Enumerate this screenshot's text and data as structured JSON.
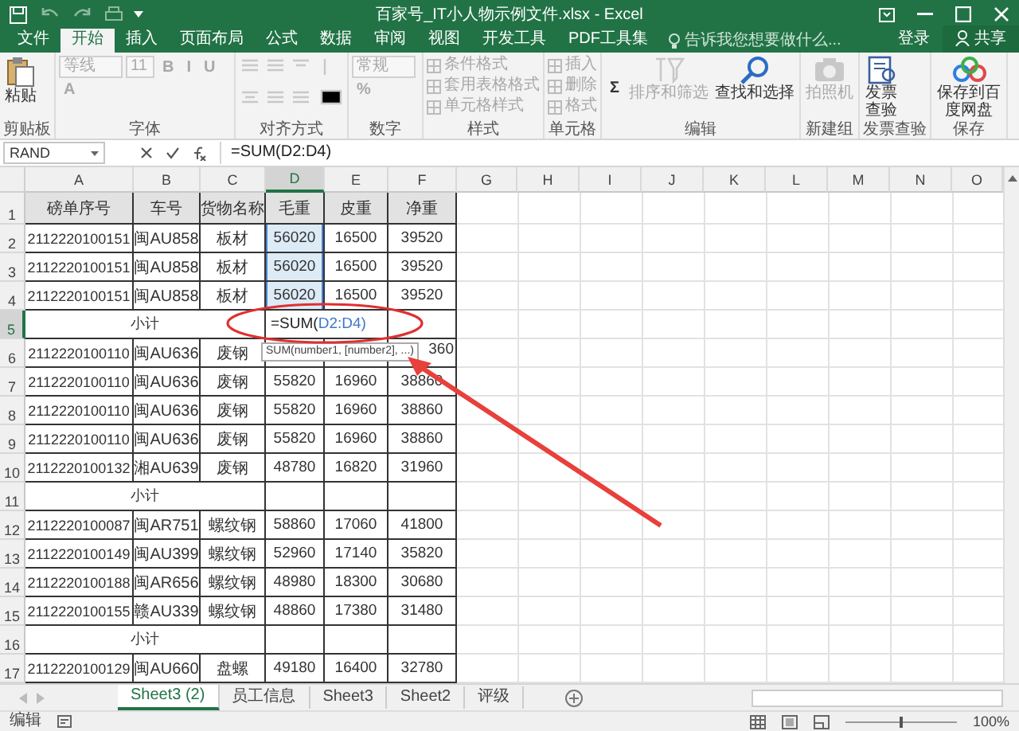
{
  "window": {
    "title": "百家号_IT小人物示例文件.xlsx - Excel"
  },
  "ribbon_tabs": [
    {
      "label": "文件",
      "selected": false
    },
    {
      "label": "开始",
      "selected": true
    },
    {
      "label": "插入",
      "selected": false
    },
    {
      "label": "页面布局",
      "selected": false
    },
    {
      "label": "公式",
      "selected": false
    },
    {
      "label": "数据",
      "selected": false
    },
    {
      "label": "审阅",
      "selected": false
    },
    {
      "label": "视图",
      "selected": false
    },
    {
      "label": "开发工具",
      "selected": false
    },
    {
      "label": "PDF工具集",
      "selected": false
    }
  ],
  "tell_me": {
    "placeholder": "告诉我您想要做什么..."
  },
  "account": {
    "sign_in": "登录",
    "share": "共享"
  },
  "ribbon_groups": [
    {
      "label": "剪贴板",
      "items": [
        {
          "kind": "paste",
          "label": "粘贴",
          "disabled": false
        }
      ]
    },
    {
      "label": "字体",
      "items": [
        {
          "kind": "field",
          "label": "等线",
          "disabled": true
        },
        {
          "kind": "field",
          "label": "11",
          "disabled": true
        },
        {
          "kind": "glyph",
          "label": "B",
          "disabled": true
        },
        {
          "kind": "glyph",
          "label": "I",
          "disabled": true
        },
        {
          "kind": "glyph",
          "label": "U",
          "disabled": true
        },
        {
          "kind": "glyph",
          "label": "A",
          "disabled": true
        }
      ]
    },
    {
      "label": "对齐方式",
      "items": [
        {
          "kind": "align",
          "disabled": true
        }
      ]
    },
    {
      "label": "数字",
      "items": [
        {
          "kind": "field",
          "label": "常规",
          "disabled": true
        },
        {
          "kind": "glyph",
          "label": "%",
          "disabled": true
        }
      ]
    },
    {
      "label": "样式",
      "items": [
        {
          "kind": "small",
          "label": "条件格式",
          "disabled": true
        },
        {
          "kind": "small",
          "label": "套用表格格式",
          "disabled": true
        },
        {
          "kind": "small",
          "label": "单元格样式",
          "disabled": true
        }
      ]
    },
    {
      "label": "单元格",
      "items": [
        {
          "kind": "small",
          "label": "插入",
          "disabled": true
        },
        {
          "kind": "small",
          "label": "删除",
          "disabled": true
        },
        {
          "kind": "small",
          "label": "格式",
          "disabled": true
        }
      ]
    },
    {
      "label": "编辑",
      "items": [
        {
          "kind": "glyph",
          "label": "Σ",
          "disabled": false
        },
        {
          "kind": "sort",
          "label": "排序和筛选",
          "disabled": true
        },
        {
          "kind": "find",
          "label": "查找和选择",
          "disabled": false
        }
      ]
    },
    {
      "label": "新建组",
      "items": [
        {
          "kind": "camera",
          "label": "拍照机",
          "disabled": true
        }
      ]
    },
    {
      "label": "发票查验",
      "items": [
        {
          "kind": "invoice",
          "label": "发票查验",
          "disabled": false
        }
      ]
    },
    {
      "label": "保存",
      "items": [
        {
          "kind": "cloud",
          "label": "保存到百度网盘",
          "disabled": false
        }
      ]
    }
  ],
  "name_box": "RAND",
  "formula_bar": {
    "value": "=SUM(D2:D4)"
  },
  "columns": [
    {
      "label": "A",
      "selected": false
    },
    {
      "label": "B",
      "selected": false
    },
    {
      "label": "C",
      "selected": false
    },
    {
      "label": "D",
      "selected": true
    },
    {
      "label": "E",
      "selected": false
    },
    {
      "label": "F",
      "selected": false
    },
    {
      "label": "G",
      "selected": false
    },
    {
      "label": "H",
      "selected": false
    },
    {
      "label": "I",
      "selected": false
    },
    {
      "label": "J",
      "selected": false
    },
    {
      "label": "K",
      "selected": false
    },
    {
      "label": "L",
      "selected": false
    },
    {
      "label": "M",
      "selected": false
    },
    {
      "label": "N",
      "selected": false
    },
    {
      "label": "O",
      "selected": false
    }
  ],
  "rows": [
    {
      "number": "1",
      "kind": "header",
      "selected": false,
      "referenced": false,
      "cells": {
        "A": "磅单序号",
        "B": "车号",
        "C": "货物名称",
        "D": "毛重",
        "E": "皮重",
        "F": "净重"
      }
    },
    {
      "number": "2",
      "kind": "data",
      "selected": false,
      "referenced": true,
      "cells": {
        "A": "2112220100151",
        "B": "闽AU858",
        "C": "板材",
        "D": "56020",
        "E": "16500",
        "F": "39520"
      }
    },
    {
      "number": "3",
      "kind": "data",
      "selected": false,
      "referenced": true,
      "cells": {
        "A": "2112220100151",
        "B": "闽AU858",
        "C": "板材",
        "D": "56020",
        "E": "16500",
        "F": "39520"
      }
    },
    {
      "number": "4",
      "kind": "data",
      "selected": false,
      "referenced": true,
      "cells": {
        "A": "2112220100151",
        "B": "闽AU858",
        "C": "板材",
        "D": "56020",
        "E": "16500",
        "F": "39520"
      }
    },
    {
      "number": "5",
      "kind": "editing",
      "selected": true,
      "referenced": false,
      "cells": {
        "A": "小计"
      },
      "edit": {
        "func": "=SUM(",
        "ref": "D2:D4)"
      }
    },
    {
      "number": "6",
      "kind": "covered",
      "selected": false,
      "referenced": false,
      "cells": {
        "A": "2112220100110",
        "B": "闽AU636",
        "C": "废钢",
        "F": "360"
      }
    },
    {
      "number": "7",
      "kind": "data",
      "selected": false,
      "referenced": false,
      "cells": {
        "A": "2112220100110",
        "B": "闽AU636",
        "C": "废钢",
        "D": "55820",
        "E": "16960",
        "F": "38860"
      }
    },
    {
      "number": "8",
      "kind": "data",
      "selected": false,
      "referenced": false,
      "cells": {
        "A": "2112220100110",
        "B": "闽AU636",
        "C": "废钢",
        "D": "55820",
        "E": "16960",
        "F": "38860"
      }
    },
    {
      "number": "9",
      "kind": "data",
      "selected": false,
      "referenced": false,
      "cells": {
        "A": "2112220100110",
        "B": "闽AU636",
        "C": "废钢",
        "D": "55820",
        "E": "16960",
        "F": "38860"
      }
    },
    {
      "number": "10",
      "kind": "data",
      "selected": false,
      "referenced": false,
      "cells": {
        "A": "2112220100132",
        "B": "湘AU639",
        "C": "废钢",
        "D": "48780",
        "E": "16820",
        "F": "31960"
      }
    },
    {
      "number": "11",
      "kind": "subtotal",
      "selected": false,
      "referenced": false,
      "cells": {
        "A": "小计"
      }
    },
    {
      "number": "12",
      "kind": "data",
      "selected": false,
      "referenced": false,
      "cells": {
        "A": "2112220100087",
        "B": "闽AR751",
        "C": "螺纹钢",
        "D": "58860",
        "E": "17060",
        "F": "41800"
      }
    },
    {
      "number": "13",
      "kind": "data",
      "selected": false,
      "referenced": false,
      "cells": {
        "A": "2112220100149",
        "B": "闽AU399",
        "C": "螺纹钢",
        "D": "52960",
        "E": "17140",
        "F": "35820"
      }
    },
    {
      "number": "14",
      "kind": "data",
      "selected": false,
      "referenced": false,
      "cells": {
        "A": "2112220100188",
        "B": "闽AR656",
        "C": "螺纹钢",
        "D": "48980",
        "E": "18300",
        "F": "30680"
      }
    },
    {
      "number": "15",
      "kind": "data",
      "selected": false,
      "referenced": false,
      "cells": {
        "A": "2112220100155",
        "B": "赣AU339",
        "C": "螺纹钢",
        "D": "48860",
        "E": "17380",
        "F": "31480"
      }
    },
    {
      "number": "16",
      "kind": "subtotal",
      "selected": false,
      "referenced": false,
      "cells": {
        "A": "小计"
      }
    },
    {
      "number": "17",
      "kind": "data",
      "selected": false,
      "referenced": false,
      "cells": {
        "A": "2112220100129",
        "B": "闽AU660",
        "C": "盘螺",
        "D": "49180",
        "E": "16400",
        "F": "32780"
      }
    }
  ],
  "tooltip": {
    "text": "SUM(number1, [number2], ...)"
  },
  "sheet_tabs": [
    {
      "label": "Sheet3 (2)",
      "selected": true
    },
    {
      "label": "员工信息",
      "selected": false
    },
    {
      "label": "Sheet3",
      "selected": false
    },
    {
      "label": "Sheet2",
      "selected": false
    },
    {
      "label": "评级",
      "selected": false
    }
  ],
  "status_bar": {
    "mode": "编辑",
    "zoom": "100%",
    "zoom_slider": {
      "level": 0.5
    }
  }
}
